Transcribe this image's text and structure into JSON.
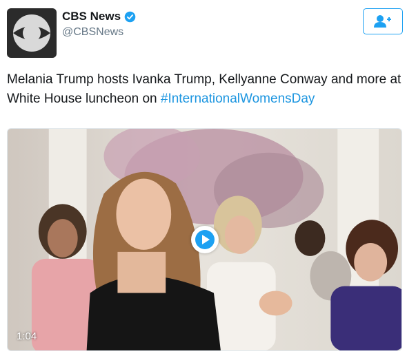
{
  "account": {
    "display_name": "CBS News",
    "handle": "@CBSNews",
    "verified_icon": "verified-badge-icon",
    "avatar_icon": "cbs-eye-logo-icon"
  },
  "follow_button": {
    "icon": "follow-person-plus-icon"
  },
  "tweet": {
    "text_part1": "Melania Trump hosts Ivanka Trump, Kellyanne Conway and more at White House luncheon on ",
    "hashtag": "#InternationalWomensDay"
  },
  "media": {
    "duration": "1:04",
    "play_icon": "play-icon"
  },
  "colors": {
    "accent": "#1da1f2",
    "hashtag": "#1b95e0",
    "handle_grey": "#657786"
  }
}
